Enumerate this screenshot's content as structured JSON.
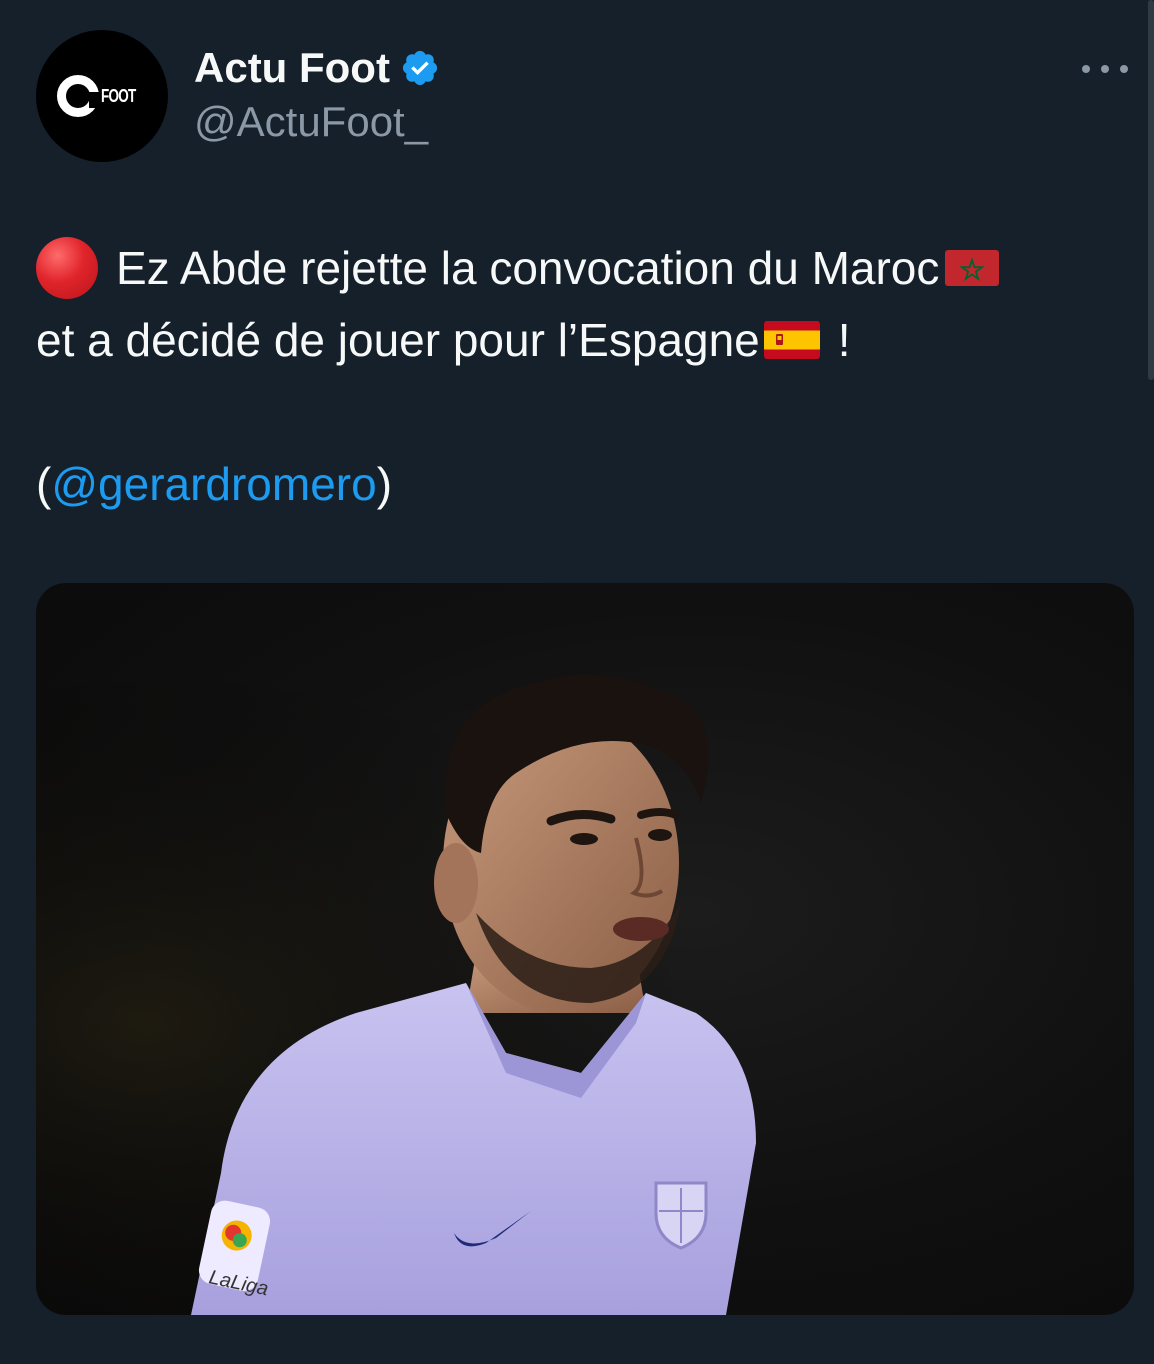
{
  "author": {
    "display_name": "Actu Foot",
    "handle": "@ActuFoot_",
    "verified": true,
    "avatar_text": "FOOT",
    "avatar_icon": "actu-foot-logo"
  },
  "menu": {
    "icon": "more-dots-icon"
  },
  "tweet": {
    "line1_text": " Ez Abde rejette la convocation du Maroc",
    "line2_text": "et a décidé de jouer pour l’Espagne",
    "line2_end": "!",
    "credit_open": "(",
    "mention": "@gerardromero",
    "credit_close": ")",
    "emoji": [
      "red-circle",
      "flag-morocco",
      "flag-spain"
    ]
  },
  "media": {
    "type": "photo",
    "badge_text": "LaLiga"
  },
  "colors": {
    "background": "#15202b",
    "text": "#f7f9f9",
    "secondary": "#8b98a5",
    "link": "#1d9bf0",
    "verified": "#1d9bf0"
  }
}
